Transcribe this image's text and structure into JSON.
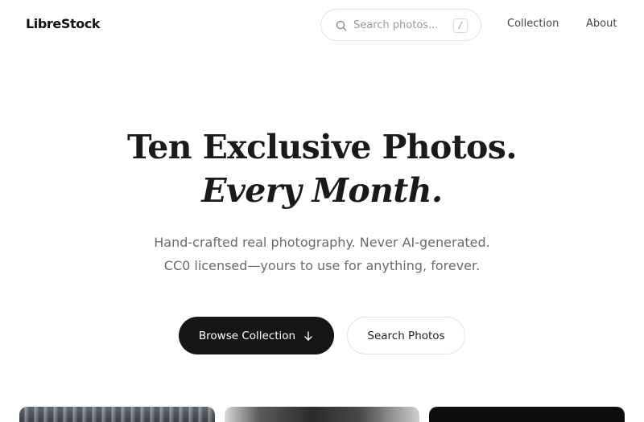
{
  "header": {
    "logo": "LibreStock",
    "search": {
      "placeholder": "Search photos...",
      "shortcut": "/"
    },
    "nav": {
      "collection": "Collection",
      "about": "About"
    }
  },
  "hero": {
    "title": "Ten Exclusive Photos.",
    "subtitle": "Every Month.",
    "description_line1": "Hand-crafted real photography. Never AI-generated.",
    "description_line2": "CC0 licensed—yours to use for anything, forever."
  },
  "actions": {
    "browse_label": "Browse Collection",
    "search_label": "Search Photos"
  },
  "icons": {
    "search": "search-icon",
    "browse_arrow": "arrow-down-icon"
  },
  "colors": {
    "primary_button": "#161616",
    "text_muted": "#6b6b6b",
    "border": "#e3e3e3"
  }
}
